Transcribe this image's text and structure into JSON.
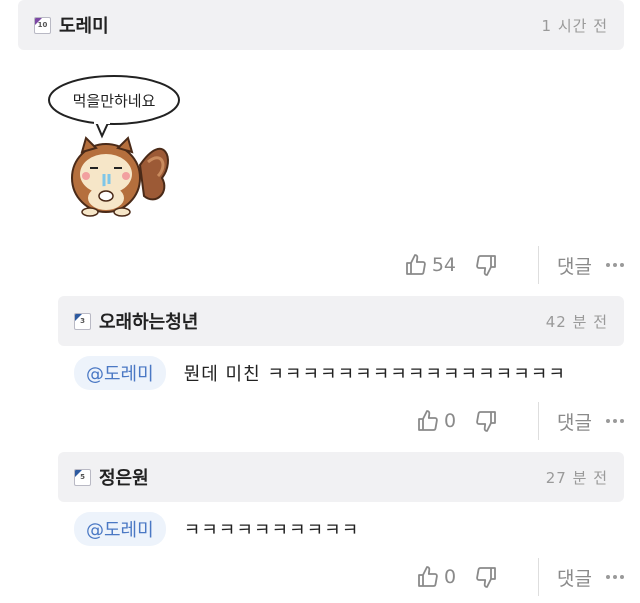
{
  "main_comment": {
    "badge": "10",
    "username": "도레미",
    "time": "1 시간 전",
    "sticker": {
      "bubble_text": "먹을만하네요",
      "character": "squirrel"
    },
    "likes": "54",
    "reply_label": "댓글"
  },
  "replies": [
    {
      "badge": "3",
      "username": "오래하는청년",
      "time": "42 분 전",
      "mention": "@도레미",
      "text": "뭔데 미친 ㅋㅋㅋㅋㅋㅋㅋㅋㅋㅋㅋㅋㅋㅋㅋㅋㅋ",
      "likes": "0",
      "reply_label": "댓글"
    },
    {
      "badge": "5",
      "username": "정은원",
      "time": "27 분 전",
      "mention": "@도레미",
      "text": "ㅋㅋㅋㅋㅋㅋㅋㅋㅋㅋ",
      "likes": "0",
      "reply_label": "댓글"
    }
  ],
  "icons": {
    "like": "thumbs-up-icon",
    "dislike": "thumbs-down-icon",
    "more": "more-dots-icon",
    "badge": "level-badge-icon"
  },
  "colors": {
    "header_bg": "#f1f1f3",
    "mention_bg": "#edf3fb",
    "mention_text": "#4a78c4",
    "meta_text": "#8a8a8a"
  }
}
